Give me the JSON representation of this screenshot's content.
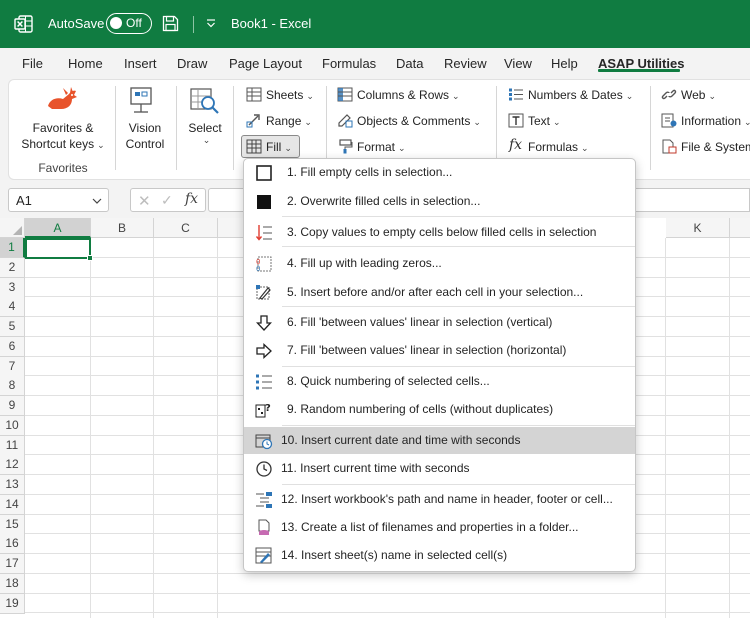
{
  "titlebar": {
    "autosave_label": "AutoSave",
    "autosave_state": "Off",
    "document_title": "Book1  -  Excel"
  },
  "ribbon_tabs": [
    "File",
    "Home",
    "Insert",
    "Draw",
    "Page Layout",
    "Formulas",
    "Data",
    "Review",
    "View",
    "Help",
    "ASAP Utilities"
  ],
  "active_tab": "ASAP Utilities",
  "ribbon": {
    "favorites_line1": "Favorites &",
    "favorites_line2": "Shortcut keys",
    "favorites_group": "Favorites",
    "vision_line1": "Vision",
    "vision_line2": "Control",
    "select_label": "Select",
    "sheets": "Sheets",
    "range": "Range",
    "fill": "Fill",
    "columns_rows": "Columns & Rows",
    "objects_comments": "Objects & Comments",
    "format": "Format",
    "numbers_dates": "Numbers & Dates",
    "text": "Text",
    "formulas": "Formulas",
    "web": "Web",
    "information": "Information",
    "file_system": "File & System"
  },
  "formula_bar": {
    "name_box": "A1",
    "formula": ""
  },
  "grid": {
    "columns_left": [
      "A",
      "B",
      "C"
    ],
    "column_right": "K",
    "rows": [
      "1",
      "2",
      "3",
      "4",
      "5",
      "6",
      "7",
      "8",
      "9",
      "10",
      "11",
      "12",
      "13",
      "14",
      "15",
      "16",
      "17",
      "18",
      "19"
    ],
    "active_cell": "A1"
  },
  "menu": {
    "items": [
      {
        "label": "1. Fill empty cells in selection...",
        "icon": "empty-square-icon"
      },
      {
        "label": "2. Overwrite filled cells in selection...",
        "icon": "filled-square-icon"
      },
      {
        "label": "3. Copy values to empty cells below filled cells in selection",
        "icon": "copy-down-icon"
      },
      {
        "label": "4. Fill up with leading zeros...",
        "icon": "leading-zeros-icon"
      },
      {
        "label": "5. Insert before and/or after each cell in your selection...",
        "icon": "insert-text-icon"
      },
      {
        "label": "6. Fill 'between values' linear in selection (vertical)",
        "icon": "arrow-down-icon"
      },
      {
        "label": "7. Fill 'between values' linear in selection (horizontal)",
        "icon": "arrow-right-icon"
      },
      {
        "label": "8. Quick numbering of selected cells...",
        "icon": "numbered-list-icon"
      },
      {
        "label": "9. Random numbering of cells (without duplicates)",
        "icon": "random-number-icon"
      },
      {
        "label": "10. Insert current date and time with seconds",
        "icon": "calendar-clock-icon"
      },
      {
        "label": "11. Insert current time with seconds",
        "icon": "clock-icon"
      },
      {
        "label": "12. Insert workbook's path and name in header, footer or cell...",
        "icon": "workbook-path-icon"
      },
      {
        "label": "13. Create a list of filenames and properties in a folder...",
        "icon": "folder-list-icon"
      },
      {
        "label": "14. Insert sheet(s) name in selected cell(s)",
        "icon": "sheet-name-icon"
      }
    ],
    "highlighted_index": 9
  },
  "colors": {
    "excel_green": "#107c41",
    "hover_gray": "#d4d4d4",
    "icon_blue": "#2e75b6",
    "icon_red": "#e03c31"
  }
}
